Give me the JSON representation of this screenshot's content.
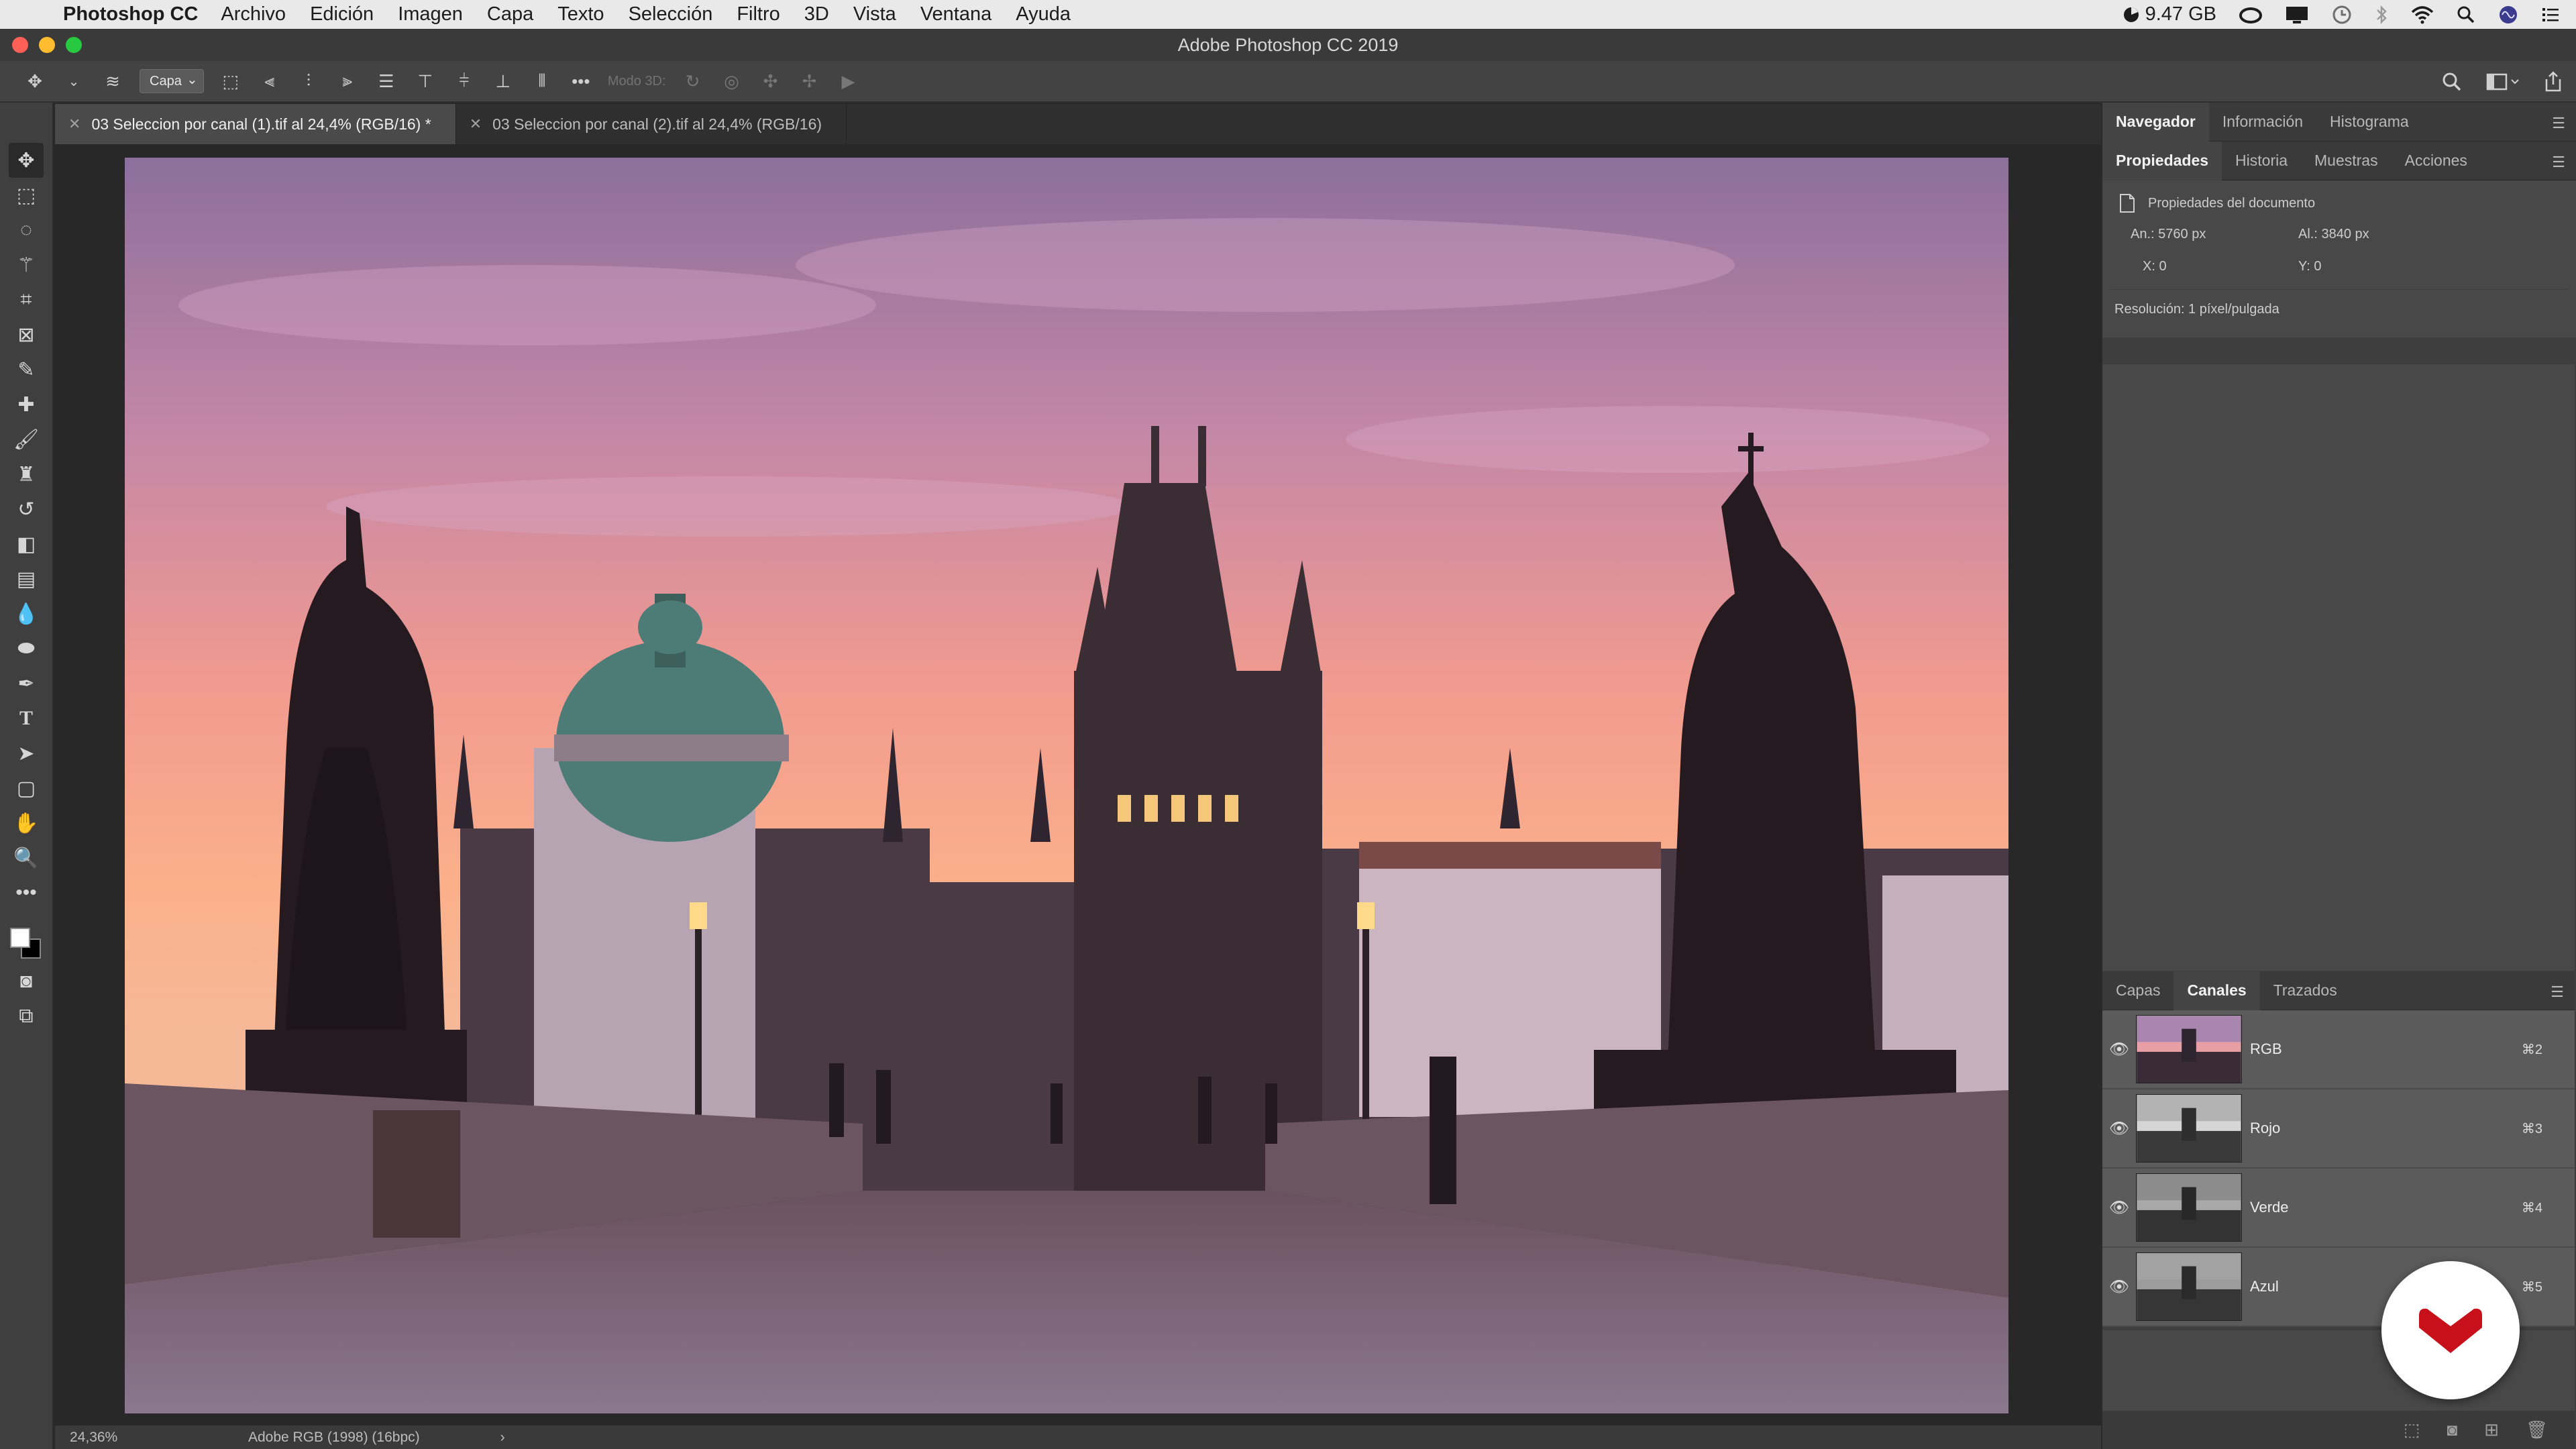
{
  "menubar": {
    "app_name": "Photoshop CC",
    "items": [
      "Archivo",
      "Edición",
      "Imagen",
      "Capa",
      "Texto",
      "Selección",
      "Filtro",
      "3D",
      "Vista",
      "Ventana",
      "Ayuda"
    ],
    "memory": "9.47 GB"
  },
  "window": {
    "title": "Adobe Photoshop CC 2019"
  },
  "options_bar": {
    "layer_select": "Capa",
    "mode_3d": "Modo 3D:"
  },
  "tabs": [
    {
      "label": "03 Seleccion por canal (1).tif al 24,4% (RGB/16) *",
      "active": true
    },
    {
      "label": "03 Seleccion por canal (2).tif al 24,4% (RGB/16)",
      "active": false
    }
  ],
  "status": {
    "zoom": "24,36%",
    "profile": "Adobe RGB (1998) (16bpc)",
    "arrow": "›"
  },
  "panels": {
    "top_tabs": [
      "Navegador",
      "Información",
      "Histograma"
    ],
    "second_tabs": [
      "Propiedades",
      "Historia",
      "Muestras",
      "Acciones"
    ],
    "properties": {
      "header": "Propiedades del documento",
      "width_label": "An.:",
      "width_value": "5760 px",
      "height_label": "Al.:",
      "height_value": "3840 px",
      "x_label": "X:",
      "x_value": "0",
      "y_label": "Y:",
      "y_value": "0",
      "resolution": "Resolución: 1 píxel/pulgada"
    },
    "channel_tabs": [
      "Capas",
      "Canales",
      "Trazados"
    ],
    "channels": [
      {
        "name": "RGB",
        "shortcut": "⌘2"
      },
      {
        "name": "Rojo",
        "shortcut": "⌘3"
      },
      {
        "name": "Verde",
        "shortcut": "⌘4"
      },
      {
        "name": "Azul",
        "shortcut": "⌘5"
      }
    ]
  },
  "colors": {
    "accent_red": "#c8101a",
    "ui_dark": "#282828",
    "panel": "#484848"
  }
}
